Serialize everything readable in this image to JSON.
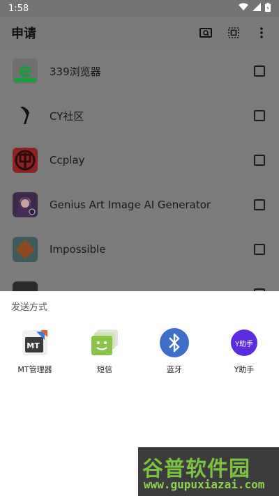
{
  "status_bar": {
    "time": "1:58"
  },
  "app_bar": {
    "title": "申请"
  },
  "apps": [
    {
      "name": "339浏览器",
      "icon": "339-browser-icon"
    },
    {
      "name": "CY社区",
      "icon": "cy-community-icon"
    },
    {
      "name": "Ccplay",
      "icon": "ccplay-icon"
    },
    {
      "name": "Genius Art Image AI Generator",
      "icon": "genius-art-icon"
    },
    {
      "name": "Impossible",
      "icon": "impossible-icon"
    }
  ],
  "share_sheet": {
    "title": "发送方式",
    "targets": [
      {
        "label": "MT管理器",
        "icon": "mt-manager-icon",
        "icon_text": "MT"
      },
      {
        "label": "短信",
        "icon": "sms-icon"
      },
      {
        "label": "蓝牙",
        "icon": "bluetooth-icon"
      },
      {
        "label": "Y助手",
        "icon": "y-assistant-icon",
        "icon_text": "Y助手"
      }
    ]
  },
  "watermark": {
    "title": "谷普软件园",
    "url": "www.gupuxiazai.com"
  },
  "colors": {
    "bluetooth": "#3d6ec9",
    "sms": "#8bc34a",
    "y_assistant": "#5b2be0",
    "ccplay": "#c62828",
    "339": "#1a9c3a"
  }
}
